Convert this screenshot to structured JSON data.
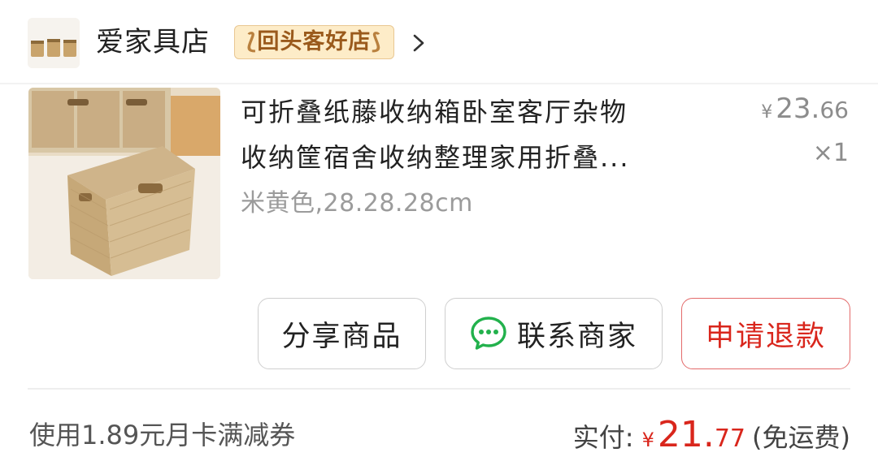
{
  "shop": {
    "name": "爱家具店",
    "badge": "回头客好店",
    "badge_left_ornament": "⟅",
    "badge_right_ornament": "⟆"
  },
  "product": {
    "title_line1": "可折叠纸藤收纳箱卧室客厅杂物",
    "title_line2": "收纳筐宿舍收纳整理家用折叠...",
    "variant": "米黄色,28.28.28cm",
    "price_symbol": "¥",
    "price_int": "23.",
    "price_dec": "66",
    "quantity": "×1"
  },
  "actions": {
    "share_label": "分享商品",
    "contact_label": "联系商家",
    "refund_label": "申请退款"
  },
  "footer": {
    "coupon_text": "使用1.89元月卡满减券",
    "paid_label": "实付:",
    "paid_symbol": "¥",
    "paid_int": "21.",
    "paid_dec": "77",
    "shipping_note": "(免运费)"
  },
  "icons": {
    "shop_logo": "shop-logo-baskets",
    "chevron": "chevron-right-icon",
    "wechat": "wechat-chat-icon"
  },
  "colors": {
    "accent_red": "#d9261c",
    "badge_bg": "#fdecc8",
    "badge_text": "#9a5a1c",
    "wechat_green": "#22b14c"
  }
}
